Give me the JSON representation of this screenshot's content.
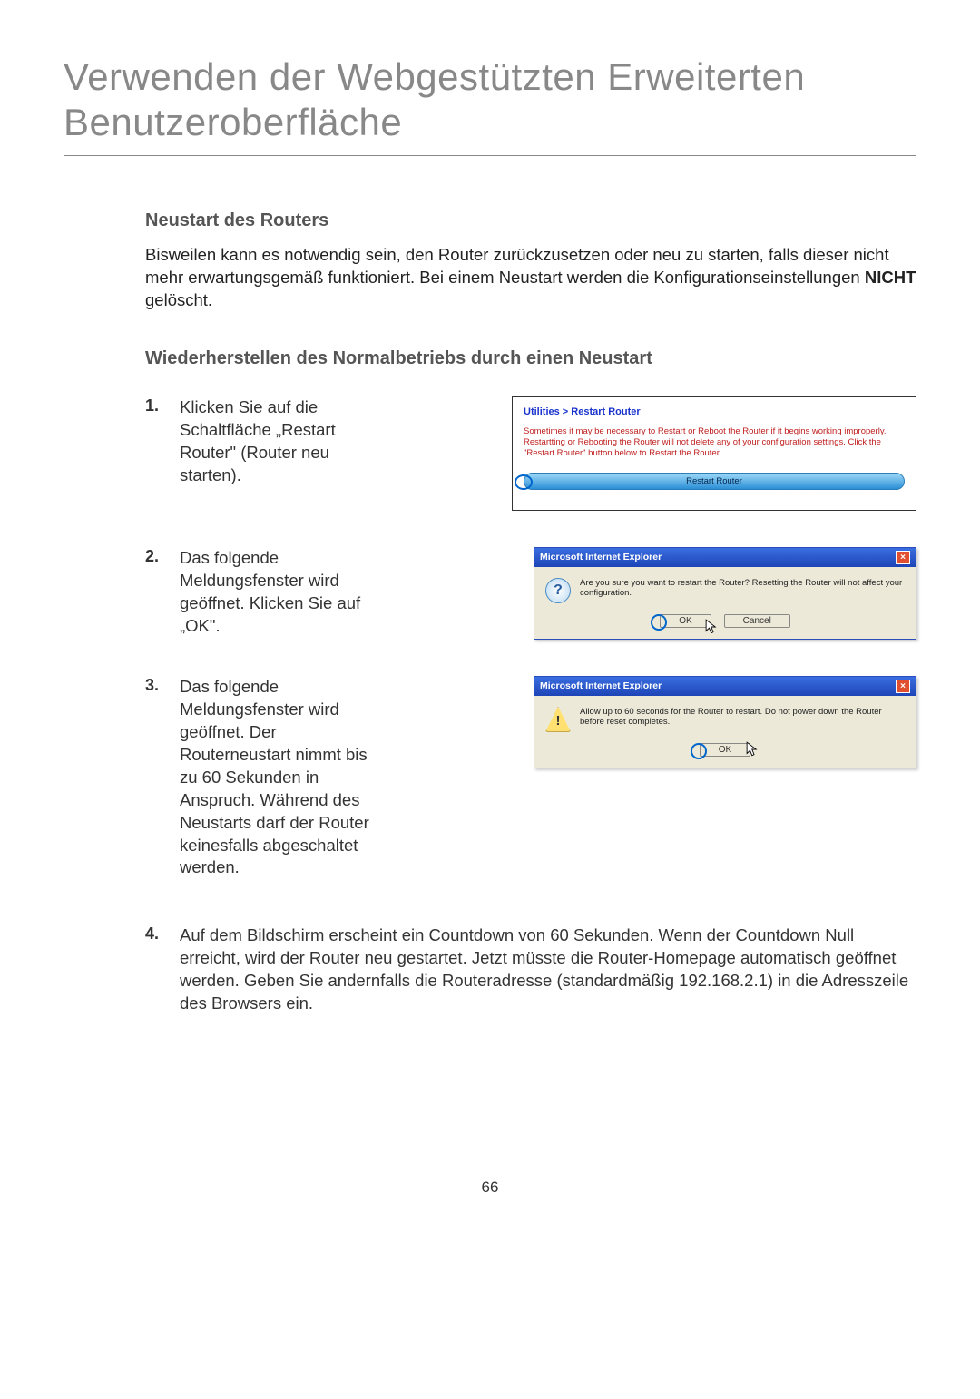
{
  "title_line1": "Verwenden der Webgestützten Erweiterten",
  "title_line2": "Benutzeroberfläche",
  "section_heading": "Neustart des Routers",
  "intro_part1": "Bisweilen kann es notwendig sein, den Router zurückzusetzen oder neu zu starten, falls dieser nicht mehr erwartungsgemäß funktioniert. Bei einem Neustart werden die Konfigurationseinstellungen ",
  "intro_bold": "NICHT",
  "intro_part2": " gelöscht.",
  "sub_heading": "Wiederherstellen des Normalbetriebs durch einen Neustart",
  "steps": {
    "s1": {
      "num": "1.",
      "text": "Klicken Sie auf die Schaltfläche „Restart Router\" (Router neu starten)."
    },
    "s2": {
      "num": "2.",
      "text": "Das folgende Meldungsfenster wird geöffnet. Klicken Sie auf „OK\"."
    },
    "s3": {
      "num": "3.",
      "text": "Das folgende Meldungsfenster wird geöffnet. Der Routerneustart nimmt bis zu 60 Sekunden in Anspruch. Während des Neustarts darf der Router keinesfalls abgeschaltet werden."
    },
    "s4": {
      "num": "4.",
      "text": "Auf dem Bildschirm erscheint ein Countdown von 60 Sekunden. Wenn der Countdown Null erreicht, wird der Router neu gestartet. Jetzt müsste die Router-Homepage automatisch geöffnet werden. Geben Sie andernfalls die Routeradresse (standardmäßig 192.168.2.1) in die Adresszeile des Browsers ein."
    }
  },
  "panel1": {
    "breadcrumb": "Utilities > Restart Router",
    "body": "Sometimes it may be necessary to Restart or Reboot the Router if it begins working improperly. Restartting or Rebooting the Router will not delete any of your configuration settings. Click the \"Restart Router\" button below to Restart the Router.",
    "button": "Restart Router"
  },
  "dialog2": {
    "title": "Microsoft Internet Explorer",
    "msg": "Are you sure you want to restart the Router? Resetting the Router will not affect your configuration.",
    "ok": "OK",
    "cancel": "Cancel"
  },
  "dialog3": {
    "title": "Microsoft Internet Explorer",
    "msg": "Allow up to 60 seconds for the Router to restart. Do not power down the Router before reset completes.",
    "ok": "OK"
  },
  "page_number": "66"
}
